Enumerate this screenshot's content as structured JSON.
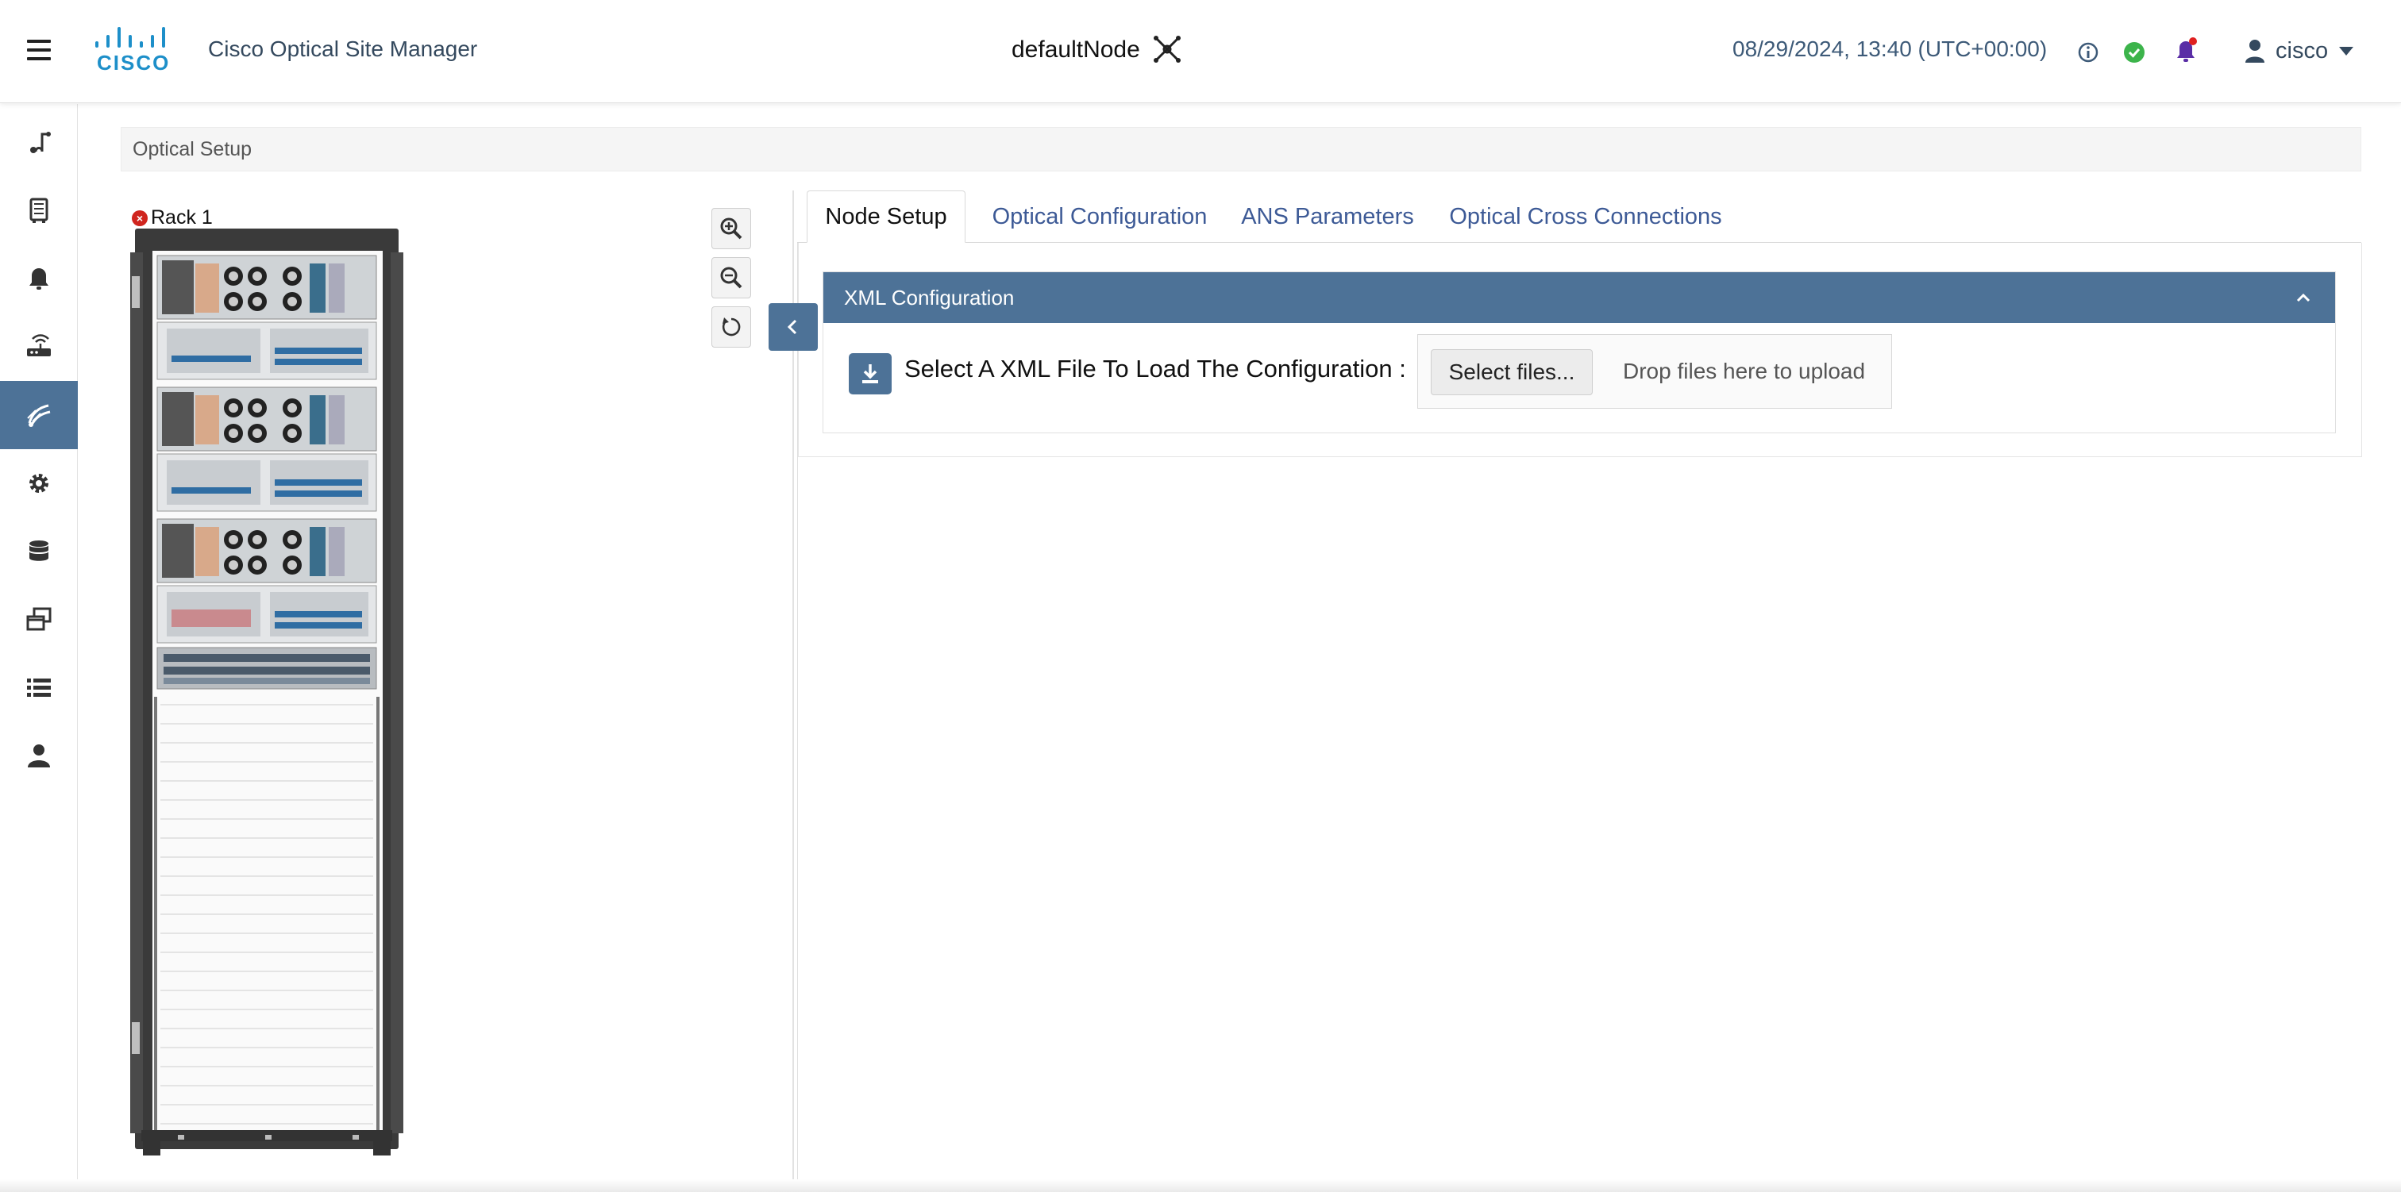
{
  "header": {
    "logo_text": "CISCO",
    "app_title": "Cisco Optical Site Manager",
    "node_name": "defaultNode",
    "datetime": "08/29/2024, 13:40 (UTC+00:00)",
    "user_name": "cisco"
  },
  "icons": {
    "menu": "hamburger-menu-icon",
    "node": "network-node-icon",
    "info": "info-icon",
    "status": "check-circle-icon",
    "notifications": "bell-icon",
    "user": "user-icon"
  },
  "colors": {
    "accent": "#4d7297",
    "brand": "#1d8fc9",
    "status_ok": "#3cb44b",
    "notification_dot": "#e02020",
    "tab_link": "#3d5a96"
  },
  "sidebar": {
    "items": [
      {
        "name": "connections-icon"
      },
      {
        "name": "device-icon"
      },
      {
        "name": "alarm-bell-icon"
      },
      {
        "name": "router-icon"
      },
      {
        "name": "optical-setup-icon",
        "active": true
      },
      {
        "name": "settings-gear-icon"
      },
      {
        "name": "database-icon"
      },
      {
        "name": "windows-icon"
      },
      {
        "name": "list-icon"
      },
      {
        "name": "users-icon"
      }
    ]
  },
  "breadcrumb": {
    "text": "Optical Setup"
  },
  "rack": {
    "label": "Rack 1",
    "status": "error"
  },
  "tabs": [
    {
      "label": "Node Setup",
      "active": true
    },
    {
      "label": "Optical Configuration"
    },
    {
      "label": "ANS Parameters"
    },
    {
      "label": "Optical Cross Connections"
    }
  ],
  "xml_config": {
    "title": "XML Configuration",
    "label": "Select A XML File To Load The Configuration :",
    "select_button": "Select files...",
    "drop_text": "Drop files here to upload"
  }
}
